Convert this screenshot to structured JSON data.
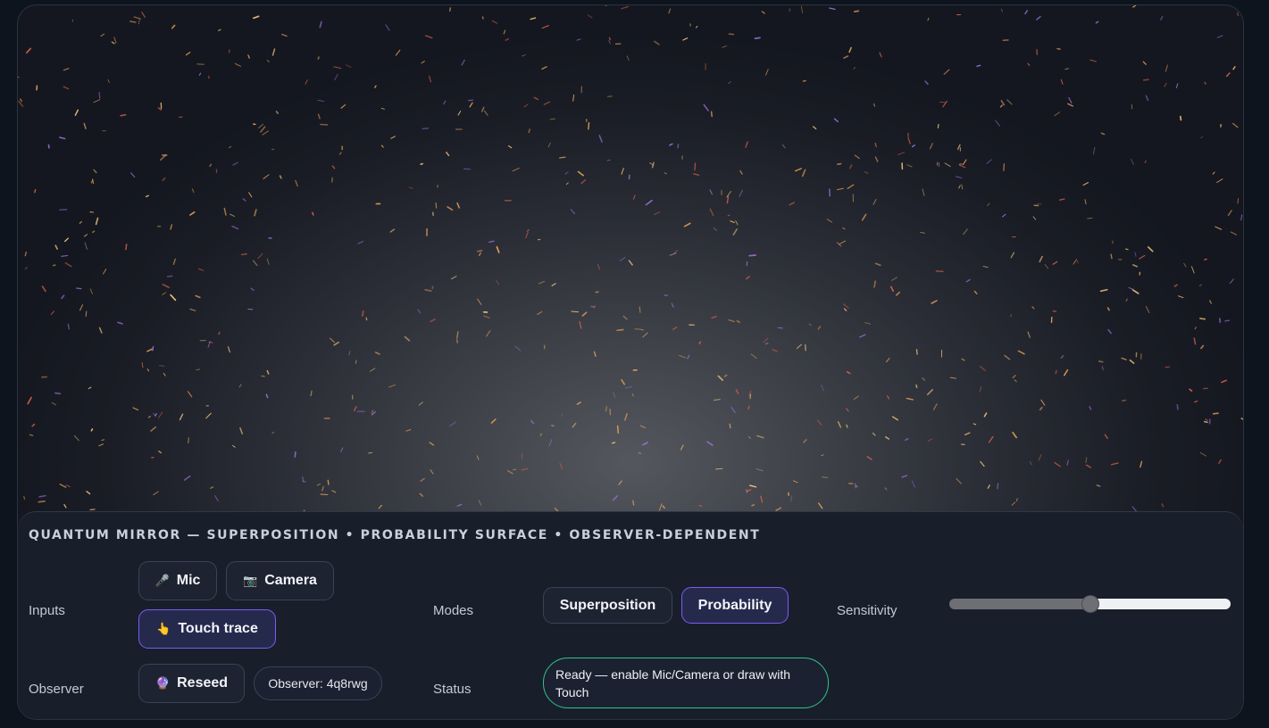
{
  "title": "QUANTUM MIRROR — SUPERPOSITION • PROBABILITY SURFACE • OBSERVER-DEPENDENT",
  "inputs": {
    "label": "Inputs",
    "mic": {
      "icon": "🎤",
      "label": "Mic"
    },
    "camera": {
      "icon": "📷",
      "label": "Camera"
    },
    "touch": {
      "icon": "👆",
      "label": "Touch trace",
      "active": true
    }
  },
  "modes": {
    "label": "Modes",
    "superposition": {
      "label": "Superposition",
      "active": false
    },
    "probability": {
      "label": "Probability",
      "active": true
    }
  },
  "sensitivity": {
    "label": "Sensitivity",
    "value": 0.5
  },
  "observer": {
    "label": "Observer",
    "reseed": {
      "icon": "🔮",
      "label": "Reseed"
    },
    "id_text": "Observer: 4q8rwg"
  },
  "status": {
    "label": "Status",
    "text": "Ready — enable Mic/Camera or draw with Touch"
  },
  "colors": {
    "accent": "#7a5cf0",
    "status_border": "#2fc48a",
    "particle_warm": "#e8a25a",
    "particle_red": "#d9614c",
    "particle_violet": "#9b6fd8"
  }
}
